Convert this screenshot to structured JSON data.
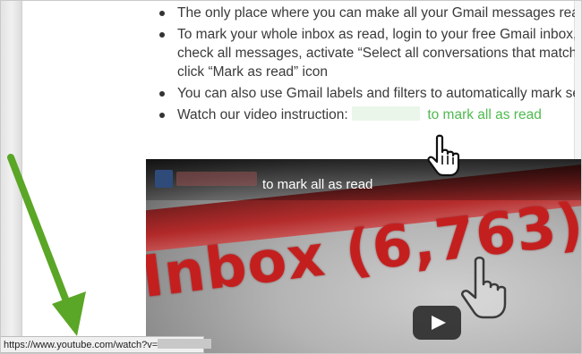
{
  "bullets": [
    {
      "lines": [
        "The only place where you can make all your Gmail messages read in"
      ]
    },
    {
      "lines": [
        "To mark your whole inbox as read, login to your free Gmail inbox, se",
        "check all messages, activate “Select all conversations that match th",
        "click “Mark as read” icon"
      ]
    },
    {
      "lines": [
        "You can also use Gmail labels and filters to automatically mark sele"
      ]
    },
    {
      "lines": [
        "Watch our video instruction:"
      ],
      "link_text": "to mark all as read"
    }
  ],
  "video": {
    "title": "to mark all as read",
    "thumbnail_text": "Inbox (6,763)",
    "play_icon": "play-icon"
  },
  "status_bar": {
    "url": "https://www.youtube.com/watch?v="
  },
  "colors": {
    "link_green": "#4fba4f",
    "arrow_green": "#5aa626",
    "inbox_red": "#c41f1f"
  }
}
